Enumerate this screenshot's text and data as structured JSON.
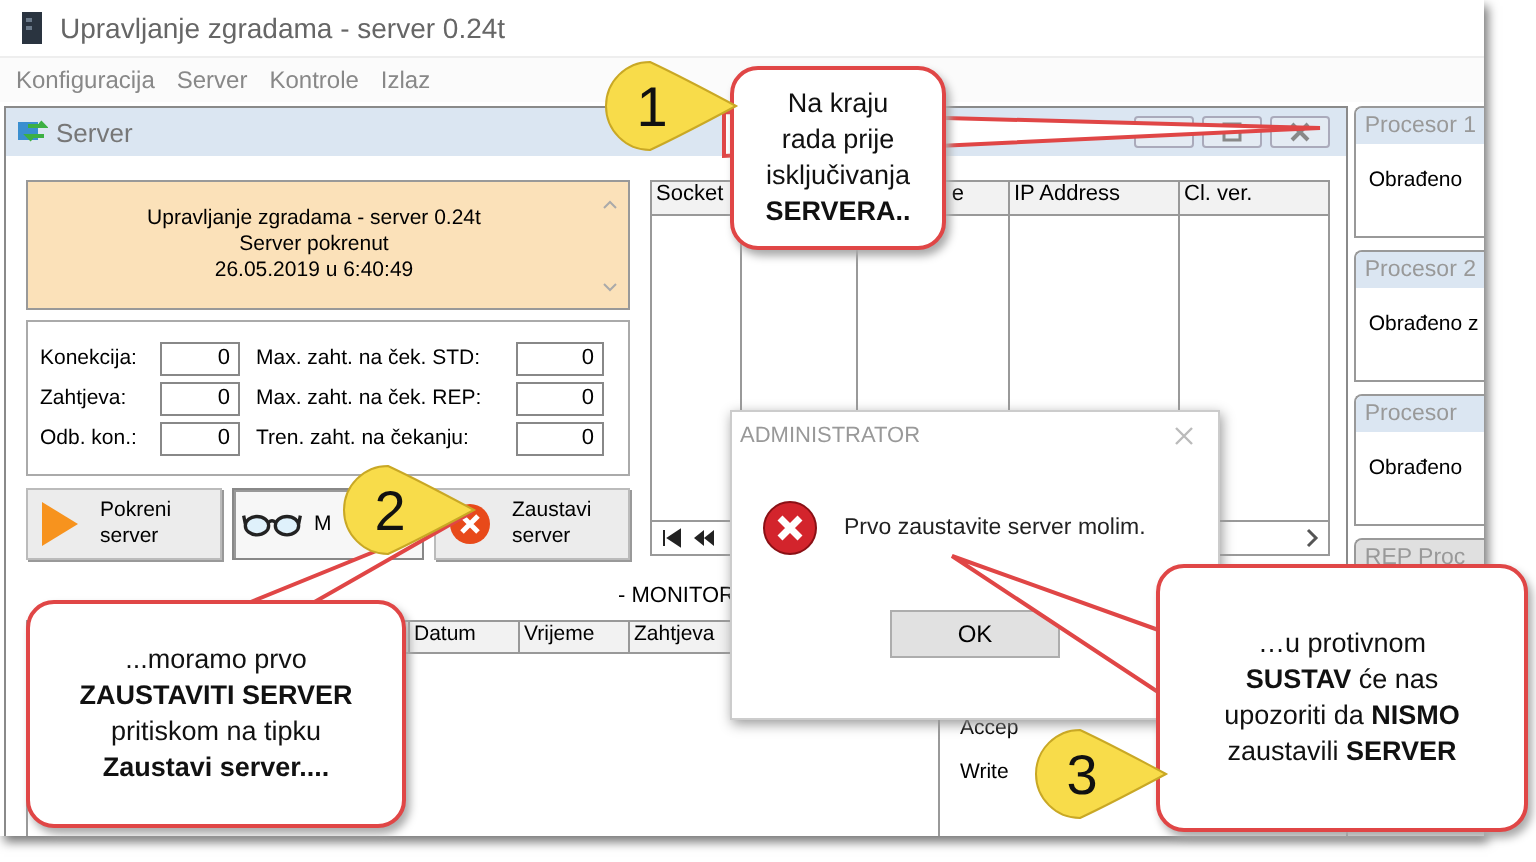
{
  "window": {
    "title": "Upravljanje zgradama - server 0.24t"
  },
  "menu": [
    "Konfiguracija",
    "Server",
    "Kontrole",
    "Izlaz"
  ],
  "server_window": {
    "title": "Server",
    "status_lines": [
      "Upravljanje zgradama - server 0.24t",
      "Server pokrenut",
      "26.05.2019 u  6:40:49"
    ],
    "stats": [
      {
        "label": "Konekcija:",
        "value": "0"
      },
      {
        "label": "Max. zaht. na ček. STD:",
        "value": "0"
      },
      {
        "label": "Zahtjeva:",
        "value": "0"
      },
      {
        "label": "Max. zaht. na ček. REP:",
        "value": "0"
      },
      {
        "label": "Odb. kon.:",
        "value": "0"
      },
      {
        "label": "Tren. zaht. na čekanju:",
        "value": "0"
      }
    ],
    "buttons": [
      {
        "kind": "start",
        "label": "Pokreni server"
      },
      {
        "kind": "monitor",
        "label": "M"
      },
      {
        "kind": "stop",
        "label": "Zaustavi server"
      }
    ],
    "socket_table": {
      "columns": [
        "Socket",
        "e",
        "IP Address",
        "Cl. ver."
      ]
    },
    "monitor": {
      "title": "- MONITOR",
      "columns": [
        "Datum",
        "Vrijeme",
        "Zahtjeva"
      ],
      "labels": [
        "Accep",
        "Write"
      ]
    }
  },
  "side_panels": [
    {
      "title": "Procesor 1",
      "label": "Obrađeno"
    },
    {
      "title": "Procesor 2",
      "label": "Obrađeno z"
    },
    {
      "title": "Procesor",
      "label": "Obrađeno"
    },
    {
      "title": "REP Proc"
    }
  ],
  "dialog": {
    "title": "ADMINISTRATOR",
    "message": "Prvo zaustavite server molim.",
    "button": "OK"
  },
  "callouts": [
    {
      "number": "1",
      "text": "Na kraju\nrada prije\nisključivanja\n**SERVERA..**"
    },
    {
      "number": "2",
      "text": "...moramo prvo\n**ZAUSTAVITI SERVER**\npritiskom na tipku\n**Zaustavi server....**"
    },
    {
      "number": "3",
      "text": "…u protivnom\n**SUSTAV** će nas\nupozoriti da **NISMO**\nzaustavili **SERVER**"
    }
  ]
}
